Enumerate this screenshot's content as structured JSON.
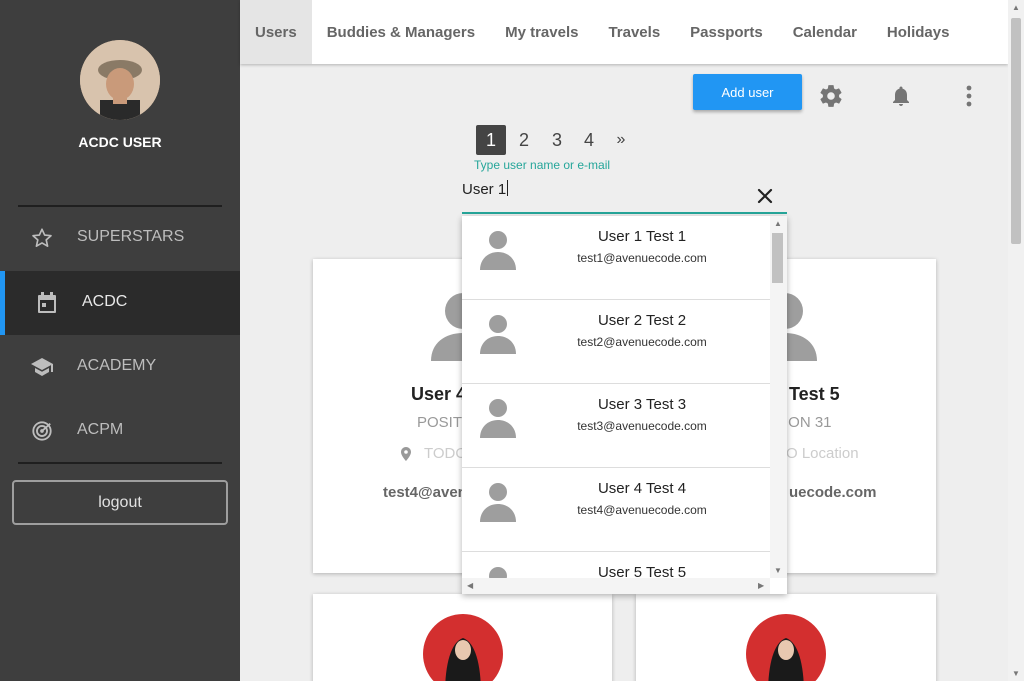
{
  "sidebar": {
    "username": "ACDC USER",
    "items": [
      {
        "label": "SUPERSTARS",
        "icon": "star-icon"
      },
      {
        "label": "ACDC",
        "icon": "calendar-icon"
      },
      {
        "label": "ACADEMY",
        "icon": "school-icon"
      },
      {
        "label": "ACPM",
        "icon": "radar-icon"
      }
    ],
    "logout_label": "logout",
    "accent_color": "#2196f3"
  },
  "tabs": [
    "Users",
    "Buddies & Managers",
    "My travels",
    "Travels",
    "Passports",
    "Calendar",
    "Holidays"
  ],
  "active_tab": "Users",
  "toolbar": {
    "add_user_label": "Add user",
    "icons": [
      "gear-icon",
      "bell-icon",
      "more-vert-icon"
    ]
  },
  "pagination": {
    "pages": [
      "1",
      "2",
      "3",
      "4"
    ],
    "next_label": "»",
    "current": "1"
  },
  "search": {
    "label": "Type user name or e-mail",
    "value": "User 1",
    "accent_color": "#26a69a"
  },
  "suggestions": [
    {
      "name": "User 1 Test 1",
      "email": "test1@avenuecode.com"
    },
    {
      "name": "User 2 Test 2",
      "email": "test2@avenuecode.com"
    },
    {
      "name": "User 3 Test 3",
      "email": "test3@avenuecode.com"
    },
    {
      "name": "User 4 Test 4",
      "email": "test4@avenuecode.com"
    },
    {
      "name": "User 5 Test 5",
      "email": ""
    }
  ],
  "cards": {
    "left": {
      "name": "User 4",
      "position": "POSITI",
      "location": "TODO",
      "email": "test4@aven"
    },
    "right": {
      "name": "Test 5",
      "position": "ION 31",
      "location": "O Location",
      "email": "uecode.com"
    }
  }
}
